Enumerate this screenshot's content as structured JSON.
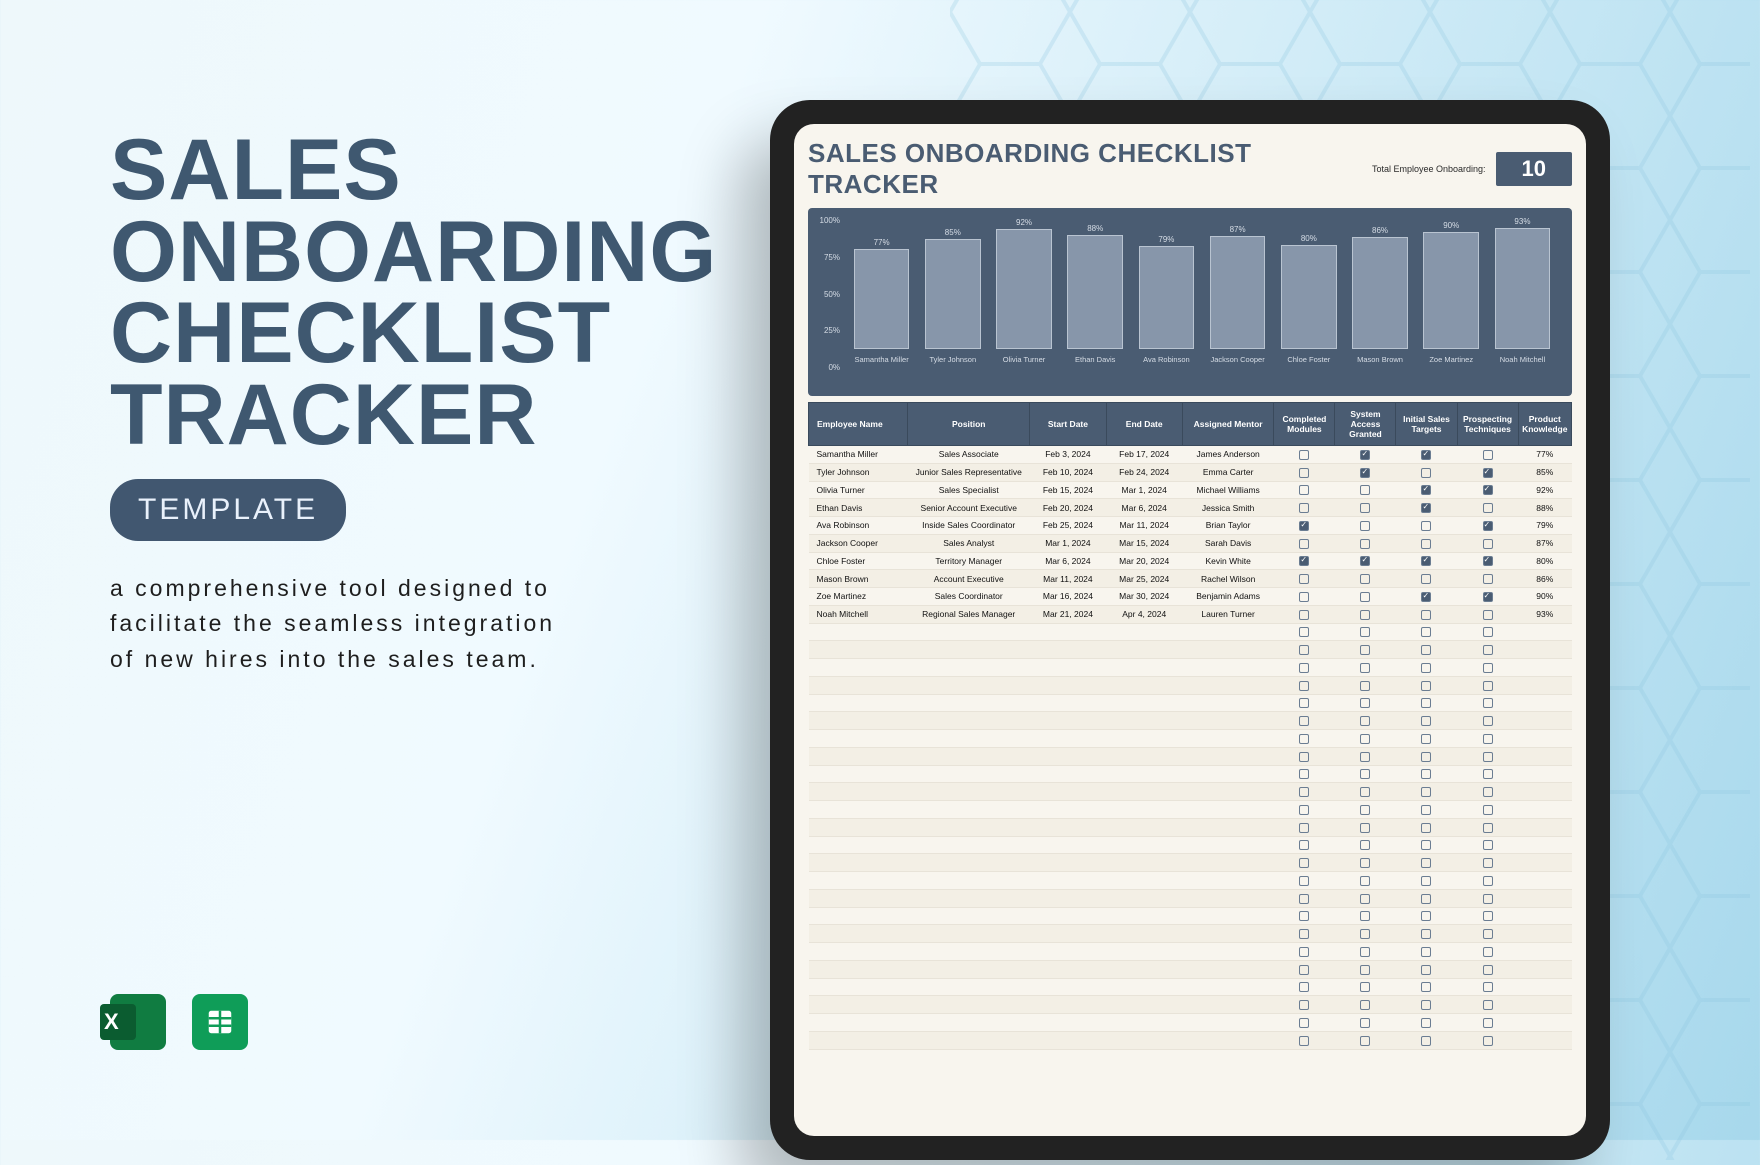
{
  "promo": {
    "title": "SALES ONBOARDING CHECKLIST TRACKER",
    "badge": "TEMPLATE",
    "description": "a comprehensive tool designed to facilitate the seamless integration of new hires into the sales team."
  },
  "tracker": {
    "title": "SALES ONBOARDING CHECKLIST TRACKER",
    "total_label": "Total Employee Onboarding:",
    "total_value": "10",
    "columns": [
      "Employee Name",
      "Position",
      "Start Date",
      "End Date",
      "Assigned Mentor",
      "Completed Modules",
      "System Access Granted",
      "Initial Sales Targets",
      "Prospecting Techniques",
      "Product Knowledge"
    ],
    "empty_rows": 24
  },
  "chart_data": {
    "type": "bar",
    "title": "",
    "ylabel": "",
    "xlabel": "",
    "ylim": [
      0,
      100
    ],
    "yticks": [
      "100%",
      "75%",
      "50%",
      "25%",
      "0%"
    ],
    "categories": [
      "Samantha Miller",
      "Tyler Johnson",
      "Olivia Turner",
      "Ethan Davis",
      "Ava Robinson",
      "Jackson Cooper",
      "Chloe Foster",
      "Mason Brown",
      "Zoe Martinez",
      "Noah Mitchell"
    ],
    "values": [
      77,
      85,
      92,
      88,
      79,
      87,
      80,
      86,
      90,
      93
    ]
  },
  "rows": [
    {
      "name": "Samantha Miller",
      "position": "Sales Associate",
      "start": "Feb 3, 2024",
      "end": "Feb 17, 2024",
      "mentor": "James Anderson",
      "completed": false,
      "access": true,
      "targets": true,
      "prospect": false,
      "product": "77%"
    },
    {
      "name": "Tyler Johnson",
      "position": "Junior Sales Representative",
      "start": "Feb 10, 2024",
      "end": "Feb 24, 2024",
      "mentor": "Emma Carter",
      "completed": false,
      "access": true,
      "targets": false,
      "prospect": true,
      "product": "85%"
    },
    {
      "name": "Olivia Turner",
      "position": "Sales Specialist",
      "start": "Feb 15, 2024",
      "end": "Mar 1, 2024",
      "mentor": "Michael Williams",
      "completed": false,
      "access": false,
      "targets": true,
      "prospect": true,
      "product": "92%"
    },
    {
      "name": "Ethan Davis",
      "position": "Senior Account Executive",
      "start": "Feb 20, 2024",
      "end": "Mar 6, 2024",
      "mentor": "Jessica Smith",
      "completed": false,
      "access": false,
      "targets": true,
      "prospect": false,
      "product": "88%"
    },
    {
      "name": "Ava Robinson",
      "position": "Inside Sales Coordinator",
      "start": "Feb 25, 2024",
      "end": "Mar 11, 2024",
      "mentor": "Brian Taylor",
      "completed": true,
      "access": false,
      "targets": false,
      "prospect": true,
      "product": "79%"
    },
    {
      "name": "Jackson Cooper",
      "position": "Sales Analyst",
      "start": "Mar 1, 2024",
      "end": "Mar 15, 2024",
      "mentor": "Sarah Davis",
      "completed": false,
      "access": false,
      "targets": false,
      "prospect": false,
      "product": "87%"
    },
    {
      "name": "Chloe Foster",
      "position": "Territory Manager",
      "start": "Mar 6, 2024",
      "end": "Mar 20, 2024",
      "mentor": "Kevin White",
      "completed": true,
      "access": true,
      "targets": true,
      "prospect": true,
      "product": "80%"
    },
    {
      "name": "Mason Brown",
      "position": "Account Executive",
      "start": "Mar 11, 2024",
      "end": "Mar 25, 2024",
      "mentor": "Rachel Wilson",
      "completed": false,
      "access": false,
      "targets": false,
      "prospect": false,
      "product": "86%"
    },
    {
      "name": "Zoe Martinez",
      "position": "Sales Coordinator",
      "start": "Mar 16, 2024",
      "end": "Mar 30, 2024",
      "mentor": "Benjamin Adams",
      "completed": false,
      "access": false,
      "targets": true,
      "prospect": true,
      "product": "90%"
    },
    {
      "name": "Noah Mitchell",
      "position": "Regional Sales Manager",
      "start": "Mar 21, 2024",
      "end": "Apr 4, 2024",
      "mentor": "Lauren Turner",
      "completed": false,
      "access": false,
      "targets": false,
      "prospect": false,
      "product": "93%"
    }
  ]
}
